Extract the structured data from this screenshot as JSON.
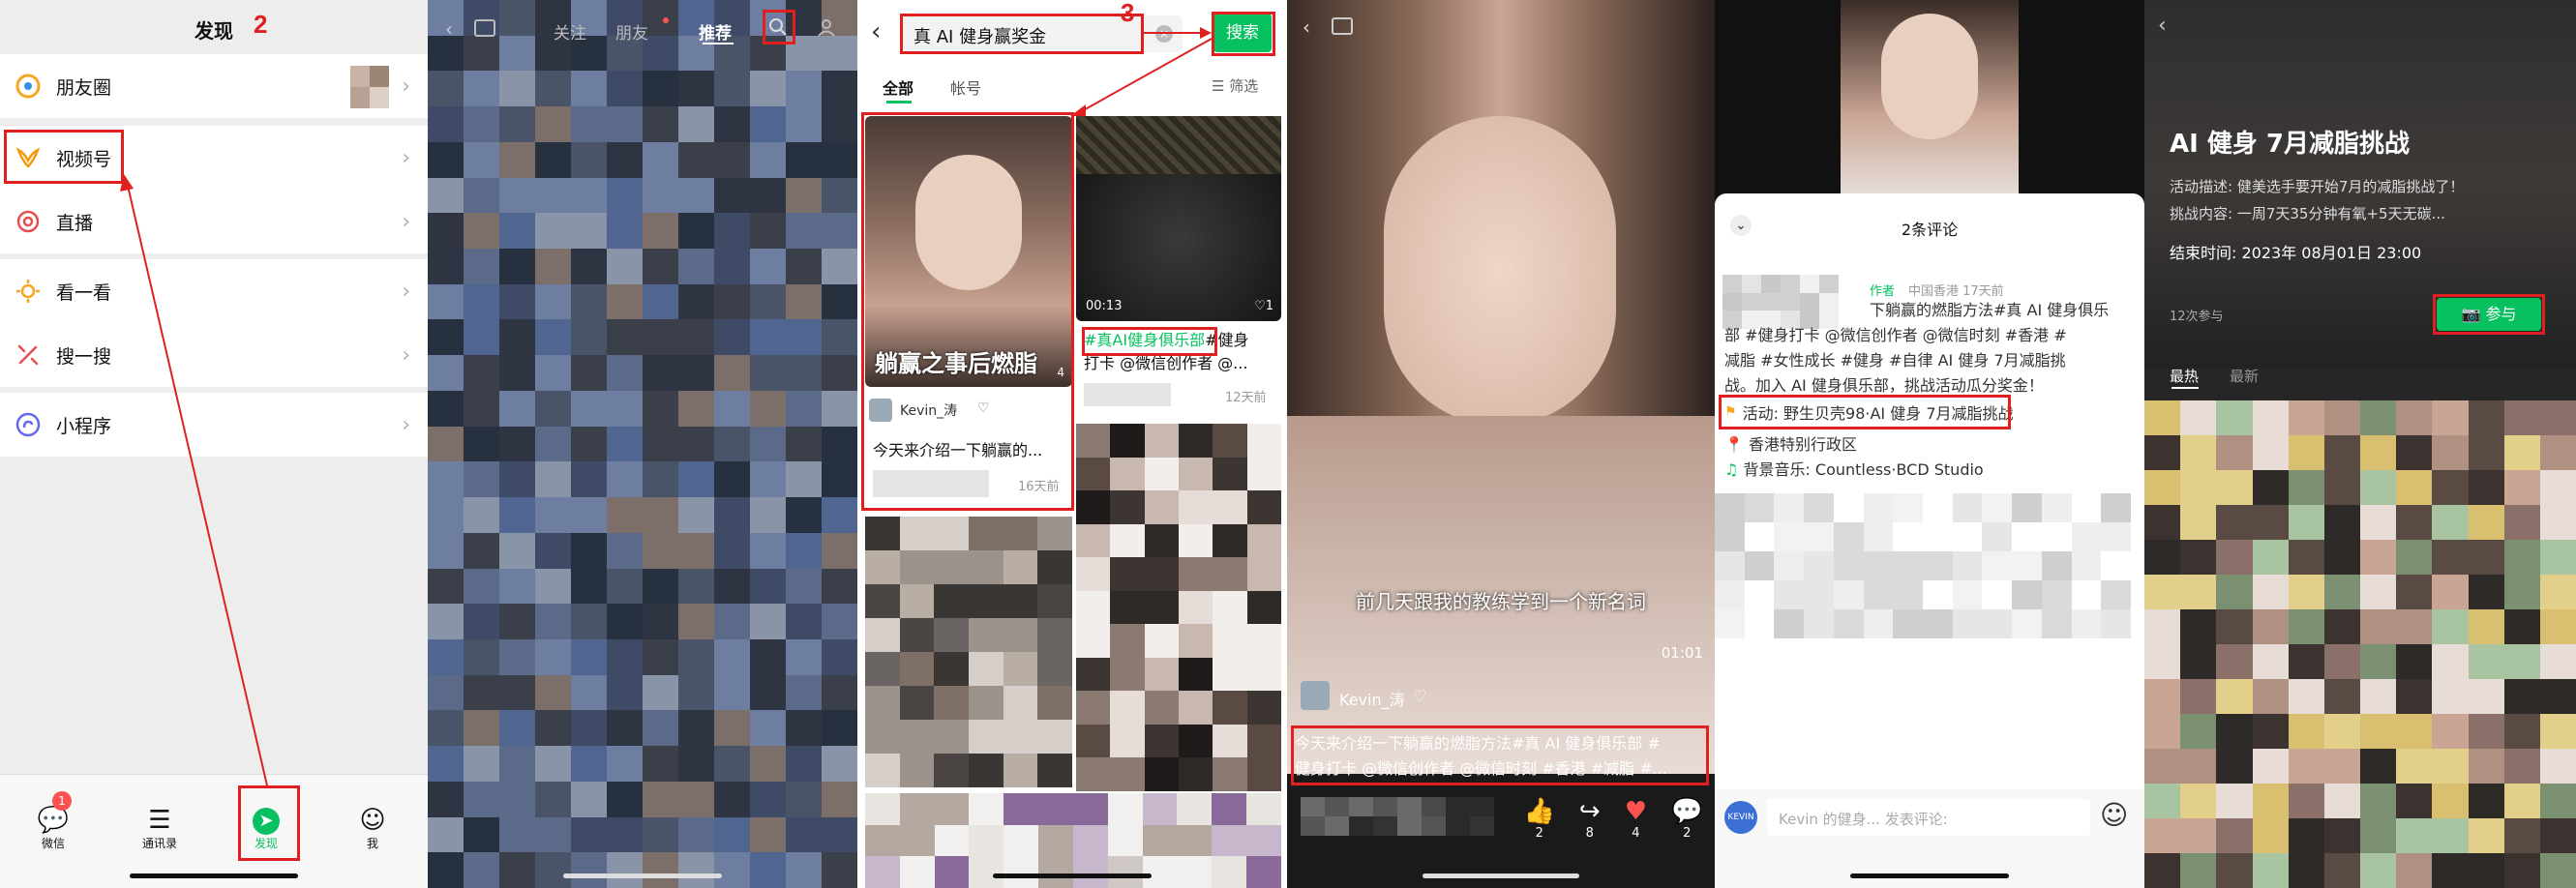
{
  "annotations": {
    "step2": "2",
    "step3": "3"
  },
  "discover": {
    "title": "发现",
    "items": [
      {
        "label": "朋友圈",
        "icon": "moments-icon",
        "color": "#f5a623"
      },
      {
        "label": "视频号",
        "icon": "channels-icon",
        "color": "#f29b0e"
      },
      {
        "label": "直播",
        "icon": "live-icon",
        "color": "#e84f4f"
      },
      {
        "label": "看一看",
        "icon": "look-icon",
        "color": "#f5a623"
      },
      {
        "label": "搜一搜",
        "icon": "search-feature-icon",
        "color": "#e84f4f"
      },
      {
        "label": "小程序",
        "icon": "miniprogram-icon",
        "color": "#6467f0"
      }
    ],
    "tabs": [
      "微信",
      "通讯录",
      "发现",
      "我"
    ],
    "badge": "1",
    "accent": "#07c160"
  },
  "channels_home": {
    "tabs": [
      "关注",
      "朋友",
      "推荐"
    ]
  },
  "search": {
    "query": "真 AI 健身赢奖金",
    "button": "搜索",
    "tabs": [
      "全部",
      "帐号"
    ],
    "filter": "筛选",
    "card1": {
      "caption": "躺赢之事后燃脂",
      "author": "Kevin_涛",
      "text": "今天来介绍一下躺赢的...",
      "time": "16天前",
      "count": "4"
    },
    "card2": {
      "duration": "00:13",
      "likes": "1",
      "tag": "#真AI健身俱乐部",
      "text_rest": "#健身",
      "text2": "打卡 @微信创作者 @...",
      "time": "12天前"
    }
  },
  "video": {
    "subtitle": "前几天跟我的教练学到一个新名词",
    "time": "01:01",
    "author": "Kevin_涛",
    "desc_line1": "今天来介绍一下躺赢的燃脂方法#真 AI 健身俱乐部 #",
    "desc_line2": "健身打卡 @微信创作者 @微信时刻 #香港 #减脂 #...",
    "counts": [
      "2",
      "8",
      "4",
      "2"
    ]
  },
  "comments": {
    "title": "2条评论",
    "author_tag": "作者",
    "meta": "中国香港 17天前",
    "body": [
      "下躺赢的燃脂方法#真 AI 健身俱乐",
      "部 #健身打卡 @微信创作者 @微信时刻 #香港 #",
      "减脂 #女性成长 #健身 #自律 AI 健身 7月减脂挑",
      "战。加入 AI 健身俱乐部，挑战活动瓜分奖金！"
    ],
    "activity": "活动: 野生贝壳98·AI 健身 7月减脂挑战",
    "location": "香港特别行政区",
    "music": "背景音乐: Countless·BCD Studio",
    "input_placeholder": "Kevin 的健身... 发表评论:",
    "avatar_text": "KEVIN"
  },
  "challenge": {
    "title": "AI 健身 7月减脂挑战",
    "desc1": "活动描述: 健美选手要开始7月的减脂挑战了！",
    "desc2": "挑战内容: 一周7天35分钟有氧+5天无碳...",
    "end": "结束时间: 2023年 08月01日 23:00",
    "participants": "12次参与",
    "join": "参与",
    "tabs": [
      "最热",
      "最新"
    ]
  }
}
